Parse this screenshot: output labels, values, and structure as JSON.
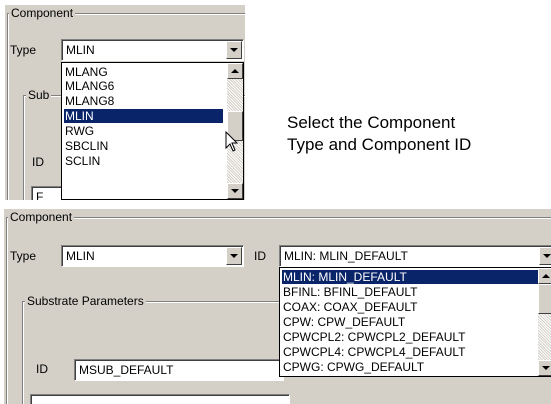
{
  "top_panel": {
    "group_title": "Component",
    "type_label": "Type",
    "type_value": "MLIN",
    "substrate_group_partial": "Sub",
    "id_label": "ID",
    "partial_field_text": "F",
    "dropdown_items": [
      "MLANG",
      "MLANG6",
      "MLANG8",
      "MLIN",
      "RWG",
      "SBCLIN",
      "SCLIN"
    ],
    "selected_item": "MLIN"
  },
  "caption": {
    "line1": "Select the Component",
    "line2": "Type and Component ID"
  },
  "bottom_panel": {
    "group_title": "Component",
    "type_label": "Type",
    "type_value": "MLIN",
    "id_label": "ID",
    "id_value": "MLIN: MLIN_DEFAULT",
    "substrate_group_title": "Substrate Parameters",
    "substrate_id_label": "ID",
    "substrate_id_value": "MSUB_DEFAULT",
    "id_dropdown_items": [
      "MLIN: MLIN_DEFAULT",
      "BFINL: BFINL_DEFAULT",
      "COAX: COAX_DEFAULT",
      "CPW: CPW_DEFAULT",
      "CPWCPL2: CPWCPL2_DEFAULT",
      "CPWCPL4: CPWCPL4_DEFAULT",
      "CPWG: CPWG_DEFAULT"
    ],
    "selected_item": "MLIN: MLIN_DEFAULT"
  },
  "colors": {
    "dialog_bg": "#d4d0c8",
    "selection_bg": "#0a246a",
    "selection_text": "#ffffff"
  }
}
